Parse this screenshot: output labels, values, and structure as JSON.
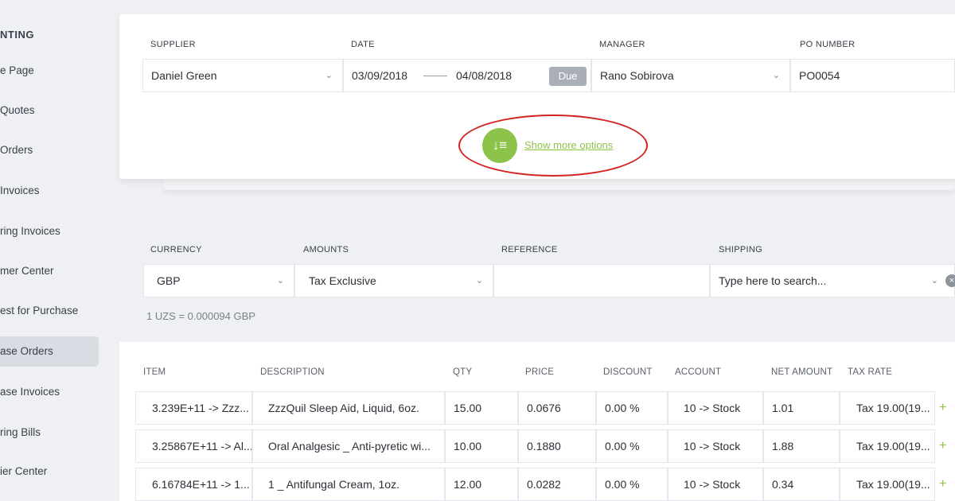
{
  "sidebar": {
    "heading": "NTING",
    "items": [
      {
        "label": "e Page"
      },
      {
        "label": "Quotes"
      },
      {
        "label": "Orders"
      },
      {
        "label": "Invoices"
      },
      {
        "label": "ring Invoices"
      },
      {
        "label": "mer Center"
      },
      {
        "label": "est for Purchase"
      },
      {
        "label": "ase Orders",
        "active": true
      },
      {
        "label": "ase Invoices"
      },
      {
        "label": "ring Bills"
      },
      {
        "label": "ier Center"
      }
    ]
  },
  "header": {
    "supplier_label": "SUPPLIER",
    "supplier_value": "Daniel Green",
    "date_label": "DATE",
    "date_from": "03/09/2018",
    "date_to": "04/08/2018",
    "due_label": "Due",
    "manager_label": "MANAGER",
    "manager_value": "Rano Sobirova",
    "po_label": "PO NUMBER",
    "po_value": "PO0054",
    "more_options_label": "Show more options"
  },
  "currency_block": {
    "currency_label": "CURRENCY",
    "currency_value": "GBP",
    "amounts_label": "AMOUNTS",
    "amounts_value": "Tax Exclusive",
    "reference_label": "REFERENCE",
    "reference_value": "",
    "shipping_label": "SHIPPING",
    "shipping_placeholder": "Type here to search...",
    "rate_text": "1 UZS = 0.000094 GBP"
  },
  "table": {
    "headers": {
      "item": "ITEM",
      "description": "DESCRIPTION",
      "qty": "QTY",
      "price": "PRICE",
      "discount": "DISCOUNT",
      "account": "ACCOUNT",
      "net_amount": "NET AMOUNT",
      "tax_rate": "TAX RATE"
    },
    "rows": [
      {
        "item": "3.239E+11 -> Zzz...",
        "description": "ZzzQuil Sleep Aid, Liquid, 6oz.",
        "qty": "15.00",
        "price": "0.0676",
        "discount": "0.00 %",
        "account": "10 -> Stock",
        "net_amount": "1.01",
        "tax_rate": "Tax 19.00(19..."
      },
      {
        "item": "3.25867E+11 -> Al...",
        "description": "Oral Analgesic _ Anti-pyretic wi...",
        "qty": "10.00",
        "price": "0.1880",
        "discount": "0.00 %",
        "account": "10 -> Stock",
        "net_amount": "1.88",
        "tax_rate": "Tax 19.00(19..."
      },
      {
        "item": "6.16784E+11 -> 1...",
        "description": "1 _ Antifungal Cream, 1oz.",
        "qty": "12.00",
        "price": "0.0282",
        "discount": "0.00 %",
        "account": "10 -> Stock",
        "net_amount": "0.34",
        "tax_rate": "Tax 19.00(19..."
      }
    ],
    "add_symbol": "+"
  },
  "colors": {
    "accent_green": "#8dc34a",
    "highlight_red": "#d2231f",
    "due_badge": "#a9aeb7"
  },
  "icons": {
    "more_options": "sort-list-icon",
    "dropdown": "chevron-down-icon",
    "clear": "clear-circle-icon",
    "add": "plus-icon"
  }
}
